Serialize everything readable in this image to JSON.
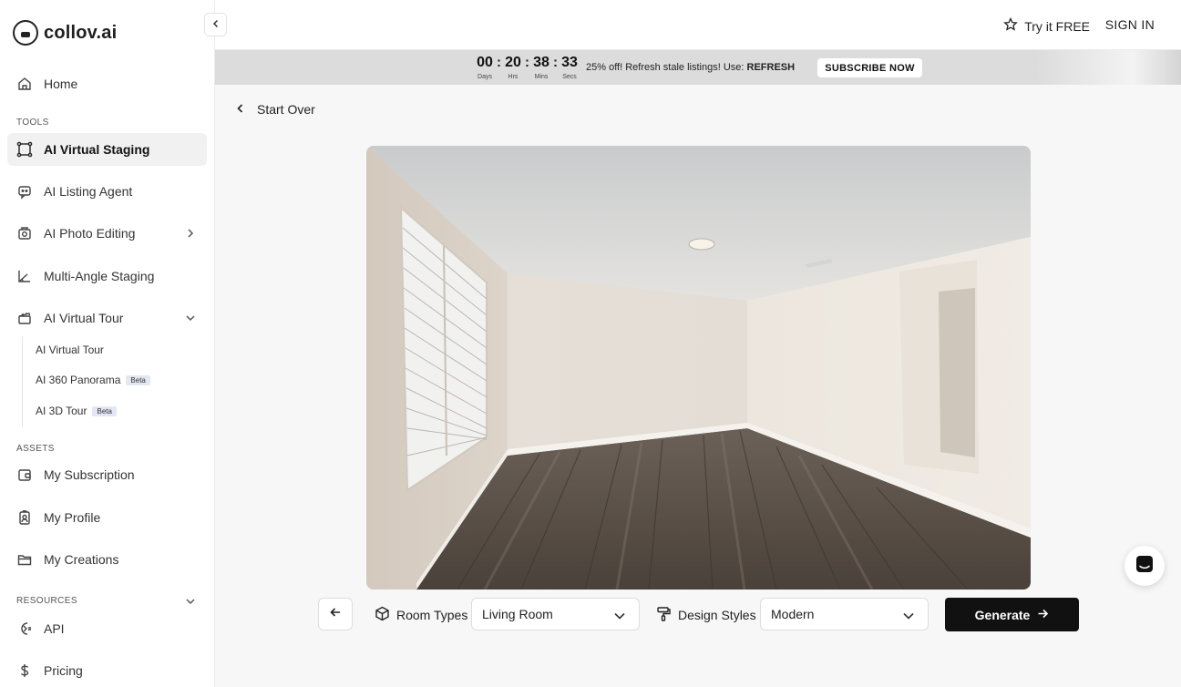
{
  "brand": {
    "name": "collov.ai"
  },
  "topbar": {
    "try_free": "Try it FREE",
    "sign_in": "SIGN IN"
  },
  "promo": {
    "countdown": [
      {
        "value": "00",
        "label": "Days"
      },
      {
        "value": "20",
        "label": "Hrs"
      },
      {
        "value": "38",
        "label": "Mins"
      },
      {
        "value": "33",
        "label": "Secs"
      }
    ],
    "text": "25% off! Refresh stale listings! Use:",
    "code": "REFRESH",
    "button": "SUBSCRIBE NOW"
  },
  "sidebar": {
    "home": "Home",
    "tools_label": "TOOLS",
    "tools": [
      {
        "label": "AI Virtual Staging",
        "icon": "frame-icon",
        "active": true
      },
      {
        "label": "AI Listing Agent",
        "icon": "chat-agent-icon"
      },
      {
        "label": "AI Photo Editing",
        "icon": "photo-edit-icon"
      },
      {
        "label": "Multi-Angle Staging",
        "icon": "angle-icon"
      },
      {
        "label": "AI Virtual Tour",
        "icon": "clapper-icon"
      }
    ],
    "tour_sub": [
      {
        "label": "AI Virtual Tour",
        "badge": ""
      },
      {
        "label": "AI 360 Panorama",
        "badge": "Beta"
      },
      {
        "label": "AI 3D Tour",
        "badge": "Beta"
      }
    ],
    "assets_label": "ASSETS",
    "assets": [
      {
        "label": "My Subscription",
        "icon": "wallet-icon"
      },
      {
        "label": "My Profile",
        "icon": "badge-icon"
      },
      {
        "label": "My Creations",
        "icon": "folder-icon"
      }
    ],
    "resources_label": "RESOURCES",
    "resources": [
      {
        "label": "API",
        "icon": "api-icon"
      },
      {
        "label": "Pricing",
        "icon": "dollar-icon"
      }
    ]
  },
  "main": {
    "start_over": "Start Over",
    "room_types_label": "Room Types",
    "room_type_value": "Living Room",
    "design_styles_label": "Design Styles",
    "design_style_value": "Modern",
    "generate": "Generate"
  }
}
